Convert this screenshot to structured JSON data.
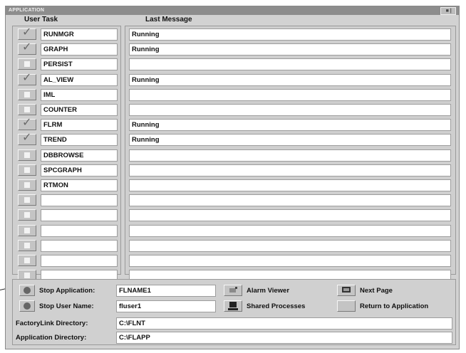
{
  "window": {
    "title": "APPLICATION",
    "controls": " ■ |"
  },
  "headers": {
    "user_task": "User Task",
    "last_message": "Last Message"
  },
  "tasks": [
    {
      "checked": true,
      "name": "RUNMGR",
      "message": "Running"
    },
    {
      "checked": true,
      "name": "GRAPH",
      "message": "Running"
    },
    {
      "checked": false,
      "name": "PERSIST",
      "message": ""
    },
    {
      "checked": true,
      "name": "AL_VIEW",
      "message": "Running"
    },
    {
      "checked": false,
      "name": "IML",
      "message": ""
    },
    {
      "checked": false,
      "name": "COUNTER",
      "message": ""
    },
    {
      "checked": true,
      "name": "FLRM",
      "message": "Running"
    },
    {
      "checked": true,
      "name": "TREND",
      "message": "Running"
    },
    {
      "checked": false,
      "name": "DBBROWSE",
      "message": ""
    },
    {
      "checked": false,
      "name": "SPCGRAPH",
      "message": ""
    },
    {
      "checked": false,
      "name": "RTMON",
      "message": ""
    },
    {
      "checked": false,
      "name": "",
      "message": ""
    },
    {
      "checked": false,
      "name": "",
      "message": ""
    },
    {
      "checked": false,
      "name": "",
      "message": ""
    },
    {
      "checked": false,
      "name": "",
      "message": ""
    },
    {
      "checked": false,
      "name": "",
      "message": ""
    },
    {
      "checked": false,
      "name": "",
      "message": ""
    }
  ],
  "controls": {
    "stop_application_label": "Stop Application:",
    "stop_application_value": "FLNAME1",
    "stop_user_label": "Stop User Name:",
    "stop_user_value": "fluser1",
    "alarm_viewer_label": "Alarm Viewer",
    "shared_processes_label": "Shared Processes",
    "next_page_label": "Next Page",
    "return_label": "Return to Application",
    "factorylink_dir_label": "FactoryLink Directory:",
    "factorylink_dir_value": "C:\\FLNT",
    "application_dir_label": "Application Directory:",
    "application_dir_value": "C:\\FLAPP"
  }
}
